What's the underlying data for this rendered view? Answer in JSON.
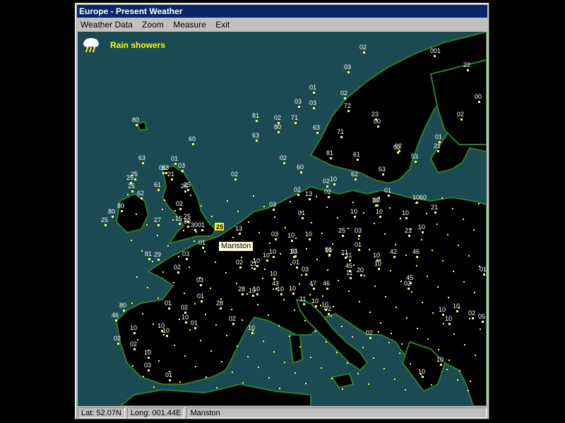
{
  "window": {
    "title": "Europe - Present Weather"
  },
  "menu": {
    "items": [
      "Weather Data",
      "Zoom",
      "Measure",
      "Exit"
    ]
  },
  "legend": {
    "icon": "rain-cloud-icon",
    "label": "Rain showers",
    "color": "#ffff00"
  },
  "tooltip": {
    "text": "Manston"
  },
  "highlight": {
    "code": "25"
  },
  "status": {
    "lat": "Lat: 52.07N",
    "long": "Long: 001.44E",
    "place": "Manston"
  },
  "colors": {
    "sea": "#1b4a52",
    "land": "#000000",
    "coast": "#2e7d2e",
    "dot": "#ffff66",
    "text": "#ffffff"
  },
  "stations": [
    {
      "code": "02"
    },
    {
      "code": "001"
    },
    {
      "code": "22"
    },
    {
      "code": "03"
    },
    {
      "code": "01"
    },
    {
      "code": "02"
    },
    {
      "code": "00"
    },
    {
      "code": "03"
    },
    {
      "code": "03"
    },
    {
      "code": "72"
    },
    {
      "code": "02"
    },
    {
      "code": "81"
    },
    {
      "code": "02"
    },
    {
      "code": "71"
    },
    {
      "code": "63"
    },
    {
      "code": "23"
    },
    {
      "code": "00"
    },
    {
      "code": "80"
    },
    {
      "code": "53"
    },
    {
      "code": "71"
    },
    {
      "code": "02"
    },
    {
      "code": "01"
    },
    {
      "code": "63"
    },
    {
      "code": "21"
    },
    {
      "code": "81"
    },
    {
      "code": "61"
    },
    {
      "code": "02"
    },
    {
      "code": "80"
    },
    {
      "code": "60"
    },
    {
      "code": "02"
    },
    {
      "code": "63"
    },
    {
      "code": "01"
    },
    {
      "code": "03"
    },
    {
      "code": "01"
    },
    {
      "code": "63"
    },
    {
      "code": "25"
    },
    {
      "code": "21"
    },
    {
      "code": "02"
    },
    {
      "code": "60"
    },
    {
      "code": "62"
    },
    {
      "code": "53"
    },
    {
      "code": "25"
    },
    {
      "code": "61"
    },
    {
      "code": "25"
    },
    {
      "code": "25"
    },
    {
      "code": "10"
    },
    {
      "code": "02"
    },
    {
      "code": "02"
    },
    {
      "code": "25"
    },
    {
      "code": "62"
    },
    {
      "code": "13"
    },
    {
      "code": "02"
    },
    {
      "code": "01"
    },
    {
      "code": "10"
    },
    {
      "code": "80"
    },
    {
      "code": "80"
    },
    {
      "code": "02"
    },
    {
      "code": "25"
    },
    {
      "code": "03"
    },
    {
      "code": "1060"
    },
    {
      "code": "10"
    },
    {
      "code": "25"
    },
    {
      "code": "27"
    },
    {
      "code": "15"
    },
    {
      "code": "21"
    },
    {
      "code": "01"
    },
    {
      "code": "10"
    },
    {
      "code": "10"
    },
    {
      "code": "10"
    },
    {
      "code": "21"
    },
    {
      "code": "80"
    },
    {
      "code": "30"
    },
    {
      "code": "01"
    },
    {
      "code": "13"
    },
    {
      "code": "01"
    },
    {
      "code": "03"
    },
    {
      "code": "10"
    },
    {
      "code": "10"
    },
    {
      "code": "25"
    },
    {
      "code": "03"
    },
    {
      "code": "10"
    },
    {
      "code": "01"
    },
    {
      "code": "10"
    },
    {
      "code": "10"
    },
    {
      "code": "10"
    },
    {
      "code": "01"
    },
    {
      "code": "21"
    },
    {
      "code": "01"
    },
    {
      "code": "03"
    },
    {
      "code": "10"
    },
    {
      "code": "81"
    },
    {
      "code": "29"
    },
    {
      "code": "03"
    },
    {
      "code": "61"
    },
    {
      "code": "10"
    },
    {
      "code": "11"
    },
    {
      "code": "10"
    },
    {
      "code": "42"
    },
    {
      "code": "46"
    },
    {
      "code": "02"
    },
    {
      "code": "02"
    },
    {
      "code": "21"
    },
    {
      "code": "10"
    },
    {
      "code": "45"
    },
    {
      "code": "10"
    },
    {
      "code": "11"
    },
    {
      "code": "20"
    },
    {
      "code": "01"
    },
    {
      "code": "03"
    },
    {
      "code": "28"
    },
    {
      "code": "10"
    },
    {
      "code": "46"
    },
    {
      "code": "10"
    },
    {
      "code": "47"
    },
    {
      "code": "45"
    },
    {
      "code": "02"
    },
    {
      "code": "01"
    },
    {
      "code": "28"
    },
    {
      "code": "10"
    },
    {
      "code": "10"
    },
    {
      "code": "11"
    },
    {
      "code": "10"
    },
    {
      "code": "43"
    },
    {
      "code": "10"
    },
    {
      "code": "02"
    },
    {
      "code": "80"
    },
    {
      "code": "01"
    },
    {
      "code": "02"
    },
    {
      "code": "46"
    },
    {
      "code": "10"
    },
    {
      "code": "10"
    },
    {
      "code": "01"
    },
    {
      "code": "10"
    },
    {
      "code": "10"
    },
    {
      "code": "02"
    },
    {
      "code": "02"
    },
    {
      "code": "10"
    },
    {
      "code": "10"
    },
    {
      "code": "02"
    },
    {
      "code": "10"
    },
    {
      "code": "02"
    },
    {
      "code": "10"
    },
    {
      "code": "02"
    },
    {
      "code": "10"
    },
    {
      "code": "05"
    },
    {
      "code": "03"
    },
    {
      "code": "01"
    },
    {
      "code": "10"
    },
    {
      "code": "10"
    }
  ]
}
